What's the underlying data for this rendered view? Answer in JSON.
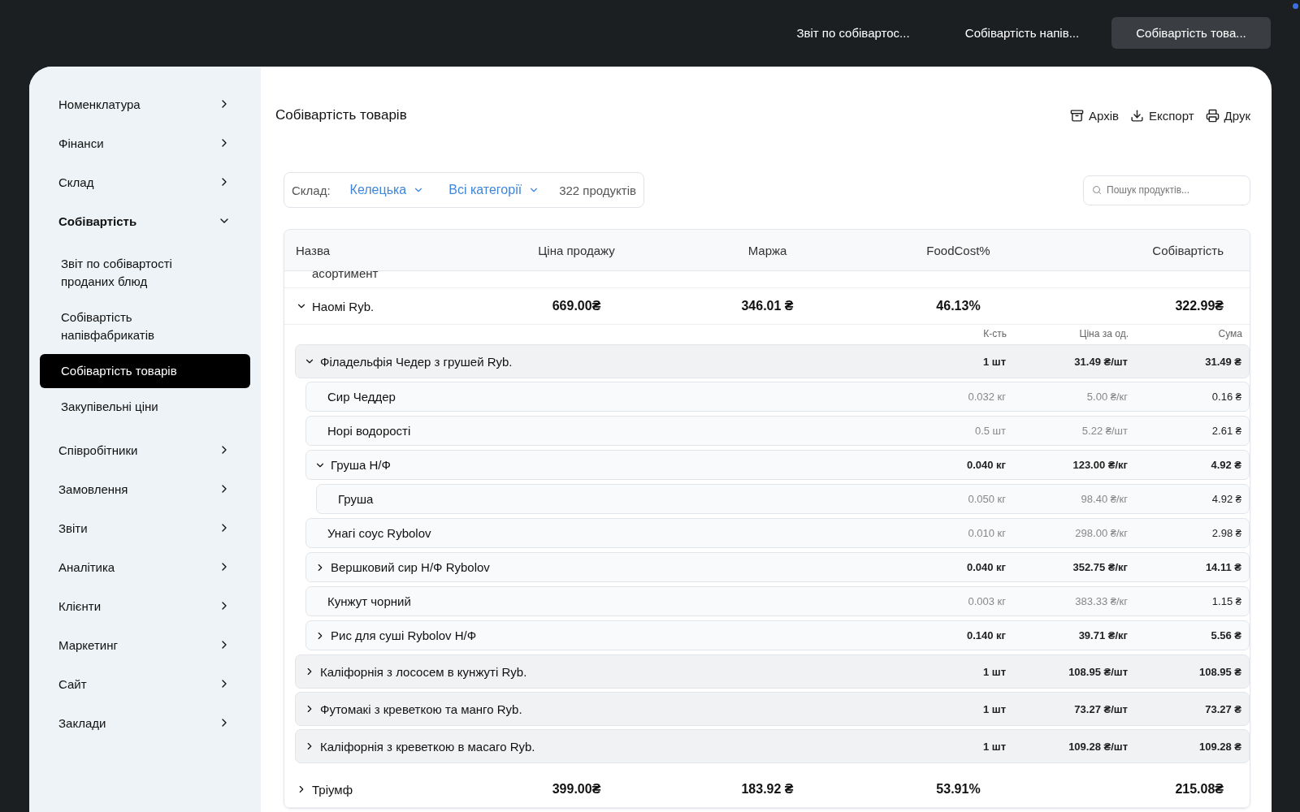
{
  "top_tabs": [
    {
      "label": "Звіт по собівартос...",
      "selected": false
    },
    {
      "label": "Собівартість напів...",
      "selected": false
    },
    {
      "label": "Собівартість това...",
      "selected": true
    }
  ],
  "sidebar": {
    "items": [
      {
        "label": "Номенклатура",
        "expanded": false
      },
      {
        "label": "Фінанси",
        "expanded": false
      },
      {
        "label": "Склад",
        "expanded": false
      },
      {
        "label": "Собівартість",
        "expanded": true,
        "children": [
          {
            "label": "Звіт по собівартості проданих блюд",
            "selected": false
          },
          {
            "label": "Собівартість напівфабрикатів",
            "selected": false
          },
          {
            "label": "Собівартість товарів",
            "selected": true
          },
          {
            "label": "Закупівельні ціни",
            "selected": false
          }
        ]
      },
      {
        "label": "Співробітники",
        "expanded": false
      },
      {
        "label": "Замовлення",
        "expanded": false
      },
      {
        "label": "Звіти",
        "expanded": false
      },
      {
        "label": "Аналітика",
        "expanded": false
      },
      {
        "label": "Клієнти",
        "expanded": false
      },
      {
        "label": "Маркетинг",
        "expanded": false
      },
      {
        "label": "Сайт",
        "expanded": false
      },
      {
        "label": "Заклади",
        "expanded": false
      }
    ]
  },
  "page": {
    "title": "Собівартість товарів",
    "actions": [
      {
        "kind": "archive",
        "label": "Архів"
      },
      {
        "kind": "export",
        "label": "Експорт"
      },
      {
        "kind": "print",
        "label": "Друк"
      }
    ]
  },
  "filters": {
    "warehouse_label": "Склад:",
    "warehouse": "Келецька",
    "category": "Всі категорії",
    "count": "322 продуктів",
    "search": {
      "placeholder": "Пошук продуктів..."
    }
  },
  "table": {
    "columns": [
      "Назва",
      "Ціна продажу",
      "Маржа",
      "FoodCost%",
      "Собівартість"
    ],
    "cut_row": "асортимент",
    "rows": [
      {
        "name": "Наомі Ryb.",
        "price": "669.00₴",
        "margin": "346.01 ₴",
        "foodcost": "46.13%",
        "cost": "322.99₴",
        "expanded": true,
        "detail_columns": [
          "К-сть",
          "Ціна за од.",
          "Сума"
        ],
        "items": [
          {
            "kind": "group",
            "name": "Філадельфія Чедер з грушей Ryb.",
            "qty": "1 шт",
            "unit_price": "31.49 ₴/шт",
            "sum": "31.49 ₴",
            "expanded": true,
            "children": [
              {
                "kind": "leaf",
                "name": "Сир Чеддер",
                "qty": "0.032 кг",
                "unit_price": "5.00 ₴/кг",
                "sum": "0.16 ₴"
              },
              {
                "kind": "leaf",
                "name": "Норі водорості",
                "qty": "0.5 шт",
                "unit_price": "5.22 ₴/шт",
                "sum": "2.61 ₴"
              },
              {
                "kind": "group",
                "name": "Груша Н/Ф",
                "qty": "0.040 кг",
                "unit_price": "123.00 ₴/кг",
                "sum": "4.92 ₴",
                "expanded": true,
                "children": [
                  {
                    "kind": "leaf",
                    "name": "Груша",
                    "qty": "0.050 кг",
                    "unit_price": "98.40 ₴/кг",
                    "sum": "4.92 ₴"
                  }
                ]
              },
              {
                "kind": "leaf",
                "name": "Унагі соус Rybolov",
                "qty": "0.010 кг",
                "unit_price": "298.00 ₴/кг",
                "sum": "2.98 ₴"
              },
              {
                "kind": "group",
                "name": "Вершковий сир Н/Ф Rybolov",
                "qty": "0.040 кг",
                "unit_price": "352.75 ₴/кг",
                "sum": "14.11 ₴",
                "expanded": false
              },
              {
                "kind": "leaf",
                "name": "Кунжут чорний",
                "qty": "0.003 кг",
                "unit_price": "383.33 ₴/кг",
                "sum": "1.15 ₴"
              },
              {
                "kind": "group",
                "name": "Рис для суші Rybolov Н/Ф",
                "qty": "0.140 кг",
                "unit_price": "39.71 ₴/кг",
                "sum": "5.56 ₴",
                "expanded": false
              }
            ]
          },
          {
            "kind": "group",
            "name": "Каліфорнія з лососем в кунжуті Ryb.",
            "qty": "1 шт",
            "unit_price": "108.95 ₴/шт",
            "sum": "108.95 ₴",
            "expanded": false
          },
          {
            "kind": "group",
            "name": "Футомакі з креветкою та манго Ryb.",
            "qty": "1 шт",
            "unit_price": "73.27 ₴/шт",
            "sum": "73.27 ₴",
            "expanded": false
          },
          {
            "kind": "group",
            "name": "Каліфорнія з креветкою в масаго Ryb.",
            "qty": "1 шт",
            "unit_price": "109.28 ₴/шт",
            "sum": "109.28 ₴",
            "expanded": false
          }
        ]
      },
      {
        "name": "Тріумф",
        "price": "399.00₴",
        "margin": "183.92 ₴",
        "foodcost": "53.91%",
        "cost": "215.08₴",
        "expanded": false
      }
    ]
  }
}
